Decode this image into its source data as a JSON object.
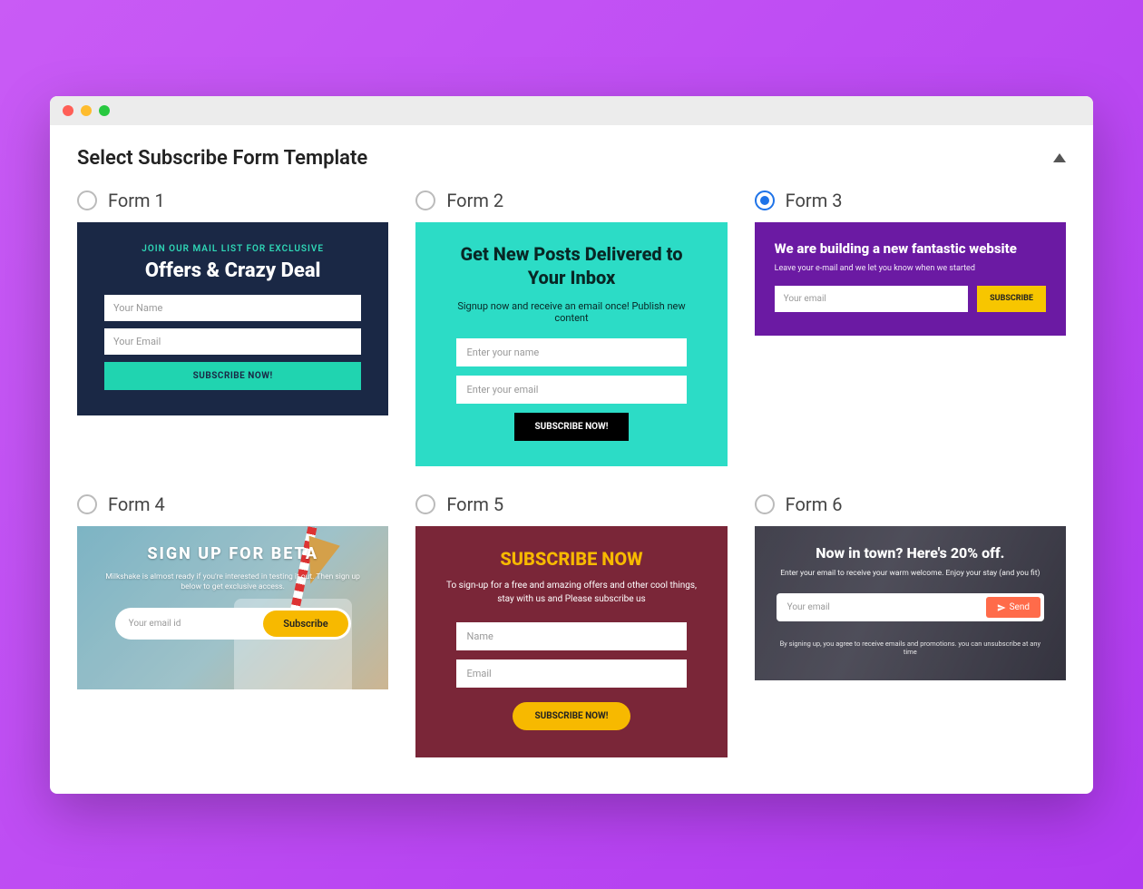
{
  "page_title": "Select Subscribe Form Template",
  "selected_form": "form3",
  "forms": {
    "form1": {
      "label": "Form 1",
      "subheading": "JOIN OUR MAIL LIST FOR EXCLUSIVE",
      "title": "Offers & Crazy Deal",
      "name_placeholder": "Your Name",
      "email_placeholder": "Your Email",
      "button": "SUBSCRIBE NOW!"
    },
    "form2": {
      "label": "Form 2",
      "title": "Get New Posts Delivered to Your Inbox",
      "subheading": "Signup now and receive an email once! Publish new content",
      "name_placeholder": "Enter your name",
      "email_placeholder": "Enter your email",
      "button": "SUBSCRIBE NOW!"
    },
    "form3": {
      "label": "Form 3",
      "title": "We are building a new fantastic website",
      "subheading": "Leave your e-mail and we let you know when we started",
      "email_placeholder": "Your email",
      "button": "SUBSCRIBE"
    },
    "form4": {
      "label": "Form 4",
      "title": "SIGN UP FOR BETA",
      "subheading": "Milkshake is almost ready if you're interested in testing it out. Then sign up below to get exclusive access.",
      "email_placeholder": "Your email id",
      "button": "Subscribe"
    },
    "form5": {
      "label": "Form 5",
      "title": "SUBSCRIBE NOW",
      "subheading": "To sign-up for a free and amazing offers and other cool things, stay with us and Please subscribe us",
      "name_placeholder": "Name",
      "email_placeholder": "Email",
      "button": "SUBSCRIBE NOW!"
    },
    "form6": {
      "label": "Form 6",
      "title": "Now in town? Here's 20% off.",
      "subheading": "Enter your email to receive your warm welcome. Enjoy your stay (and you fit)",
      "email_placeholder": "Your email",
      "button": "Send",
      "fineprint": "By signing up, you agree to receive emails and promotions. you can unsubscribe at any time"
    }
  }
}
